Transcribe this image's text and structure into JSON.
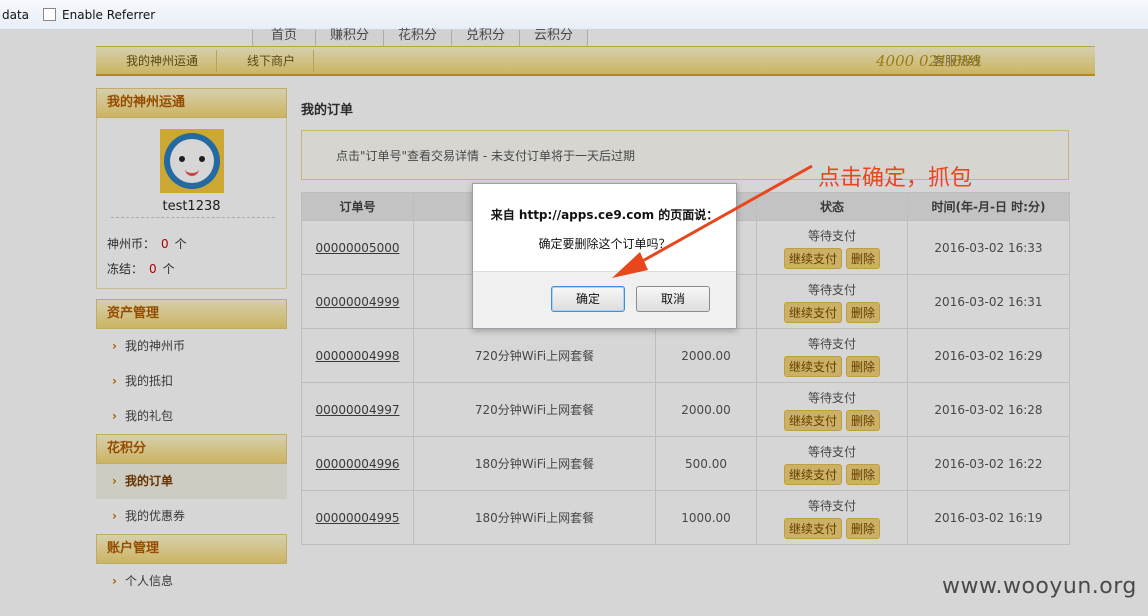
{
  "toolbar": {
    "label": "data",
    "checkbox_label": "Enable Referrer"
  },
  "nav_tabs": [
    "首页",
    "赚积分",
    "花积分",
    "兑积分",
    "云积分"
  ],
  "subnav": {
    "links": [
      "我的神州运通",
      "线下商户"
    ],
    "hotline_label": "客服热线",
    "hotline_number": "4000 021 888"
  },
  "sidebar": {
    "profile_title": "我的神州运通",
    "username": "test1238",
    "coins_label": "神州币：",
    "coins_value": "0",
    "coins_unit": "个",
    "frozen_label": "冻结：",
    "frozen_value": "0",
    "frozen_unit": "个",
    "sections": [
      {
        "title": "资产管理",
        "items": [
          "我的神州币",
          "我的抵扣",
          "我的礼包"
        ]
      },
      {
        "title": "花积分",
        "items": [
          "我的订单",
          "我的优惠券"
        ]
      },
      {
        "title": "账户管理",
        "items": [
          "个人信息"
        ]
      }
    ]
  },
  "main": {
    "title": "我的订单",
    "notice": "点击\"订单号\"查看交易详情 - 未支付订单将于一天后过期",
    "columns": [
      "订单号",
      "",
      "",
      "状态",
      "时间(年-月-日 时:分)"
    ],
    "rows": [
      {
        "id": "00000005000",
        "product": "",
        "price": "",
        "status": "等待支付",
        "time": "2016-03-02 16:33"
      },
      {
        "id": "00000004999",
        "product": "",
        "price": "",
        "status": "等待支付",
        "time": "2016-03-02 16:31"
      },
      {
        "id": "00000004998",
        "product": "720分钟WiFi上网套餐",
        "price": "2000.00",
        "status": "等待支付",
        "time": "2016-03-02 16:29"
      },
      {
        "id": "00000004997",
        "product": "720分钟WiFi上网套餐",
        "price": "2000.00",
        "status": "等待支付",
        "time": "2016-03-02 16:28"
      },
      {
        "id": "00000004996",
        "product": "180分钟WiFi上网套餐",
        "price": "500.00",
        "status": "等待支付",
        "time": "2016-03-02 16:22"
      },
      {
        "id": "00000004995",
        "product": "180分钟WiFi上网套餐",
        "price": "1000.00",
        "status": "等待支付",
        "time": "2016-03-02 16:19"
      }
    ],
    "pay_button": "继续支付",
    "delete_button": "删除"
  },
  "dialog": {
    "title": "来自 http://apps.ce9.com 的页面说：",
    "message": "确定要删除这个订单吗？",
    "ok": "确定",
    "cancel": "取消"
  },
  "annotation": {
    "text": "点击确定，抓包",
    "color": "#e8461c"
  },
  "watermark": "www.wooyun.org"
}
